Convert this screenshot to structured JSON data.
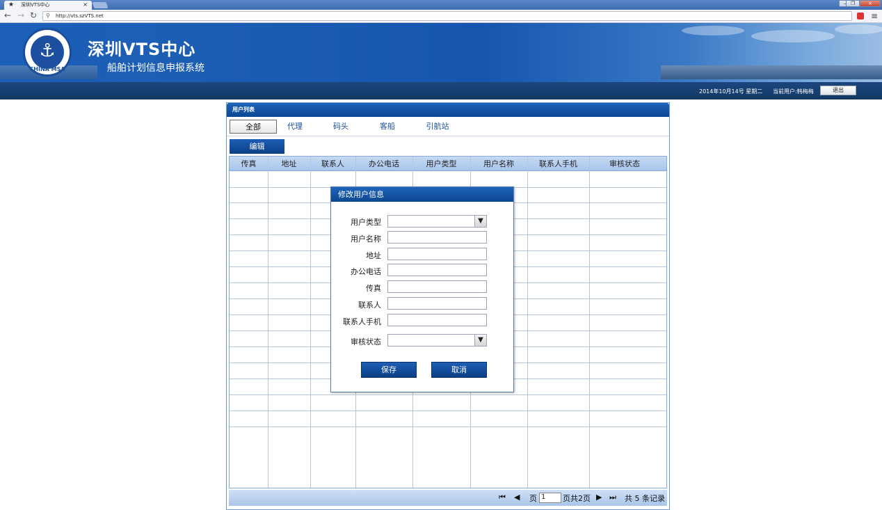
{
  "browser": {
    "tab_title": "深圳VTS中心",
    "url": "http://vts.szVTS.net",
    "tab_close": "×",
    "star_icon": "★",
    "window_minimize": "—",
    "window_restore": "❐",
    "window_close": "×"
  },
  "banner": {
    "title": "深圳VTS中心",
    "subtitle": "船舶计划信息申报系统",
    "logo_text": "CHINA MSA",
    "logo_glyph": "⚓"
  },
  "status": {
    "date": "2014年10月14号 星期二",
    "current_user": "当前用户:韩梅梅",
    "logout": "退出"
  },
  "panel": {
    "title": "用户列表",
    "tabs": [
      "全部",
      "代理",
      "码头",
      "客船",
      "引航站"
    ],
    "edit_button": "编辑",
    "columns": [
      "传真",
      "地址",
      "联系人",
      "办公电话",
      "用户类型",
      "用户名称",
      "联系人手机",
      "审核状态"
    ]
  },
  "pagination": {
    "first": "⏮",
    "prev": "◀",
    "page_label": "页",
    "page_value": "1",
    "total_pages": "页共2页",
    "next": "▶",
    "last": "⏭",
    "total_records": "共 5 条记录"
  },
  "dialog": {
    "title": "修改用户信息",
    "labels": {
      "user_type": "用户类型",
      "user_name": "用户名称",
      "address": "地址",
      "office_phone": "办公电话",
      "fax": "传真",
      "contact": "联系人",
      "contact_mobile": "联系人手机",
      "review_status": "审核状态"
    },
    "save": "保存",
    "cancel": "取消"
  }
}
